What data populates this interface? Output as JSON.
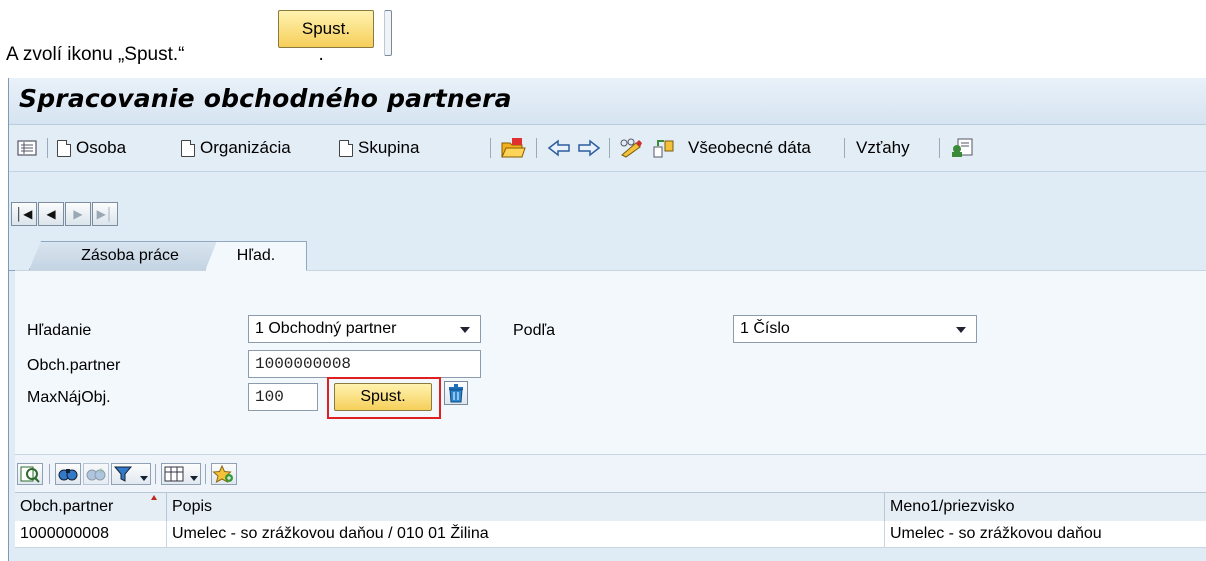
{
  "caption": {
    "text": "A zvolí ikonu „Spust.“",
    "button_label": "Spust.",
    "end": "."
  },
  "window": {
    "title": "Spracovanie obchodného partnera"
  },
  "toolbar": {
    "osoba": "Osoba",
    "organizacia": "Organizácia",
    "skupina": "Skupina",
    "vseobecne_data": "Všeobecné dáta",
    "vztahy": "Vzťahy"
  },
  "tabs": [
    "Zásoba práce",
    "Hľad."
  ],
  "search": {
    "hladanie_label": "Hľadanie",
    "hladanie_value": "1 Obchodný partner",
    "podla_label": "Podľa",
    "podla_value": "1 Číslo",
    "partner_label": "Obch.partner",
    "partner_value": "1000000008",
    "max_label": "MaxNájObj.",
    "max_value": "100",
    "start_label": "Spust."
  },
  "table": {
    "headers": [
      "Obch.partner",
      "Popis",
      "Meno1/priezvisko"
    ],
    "rows": [
      [
        "1000000008",
        "Umelec - so zrážkovou daňou / 010 01 Žilina",
        "Umelec - so zrážkovou daňou"
      ]
    ]
  },
  "colors": {
    "highlight": "#e02020",
    "button": "#f6cf5a",
    "background": "#dfebf5"
  }
}
